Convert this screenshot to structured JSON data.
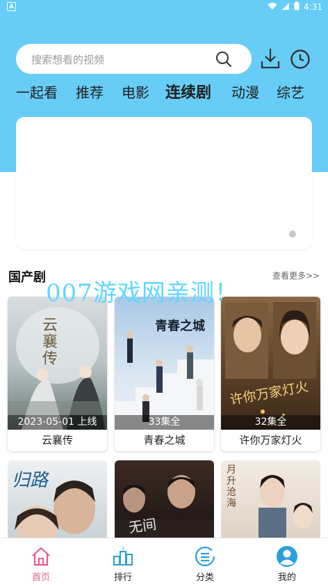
{
  "status_bar": {
    "indicator": "A",
    "time": "4:31"
  },
  "search": {
    "placeholder": "搜索想看的视频"
  },
  "tabs": [
    {
      "label": "一起看"
    },
    {
      "label": "推荐"
    },
    {
      "label": "电影"
    },
    {
      "label": "连续剧",
      "active": true
    },
    {
      "label": "动漫"
    },
    {
      "label": "综艺"
    }
  ],
  "section": {
    "title": "国产剧",
    "more": "查看更多>>"
  },
  "watermark": "007游戏网亲测！",
  "cards": [
    {
      "caption": "2023-05-01 上线",
      "name": "云襄传",
      "poster_text": "云襄传"
    },
    {
      "caption": "33集全",
      "name": "青春之城",
      "poster_text": "青春之城"
    },
    {
      "caption": "32集全",
      "name": "许你万家灯火",
      "poster_text": "许你万家灯火"
    }
  ],
  "cards_row2": [
    {
      "poster_text": "归路"
    },
    {
      "poster_text": "无间"
    },
    {
      "poster_text": "月升沧海"
    }
  ],
  "nav": [
    {
      "label": "首页",
      "icon": "home-icon",
      "active": true
    },
    {
      "label": "排行",
      "icon": "ranking-icon"
    },
    {
      "label": "分类",
      "icon": "category-icon"
    },
    {
      "label": "我的",
      "icon": "profile-icon"
    }
  ],
  "colors": {
    "header_bg": "#67cdf7",
    "active_nav": "#e85a8a",
    "icon_blue": "#2a9fd8"
  }
}
